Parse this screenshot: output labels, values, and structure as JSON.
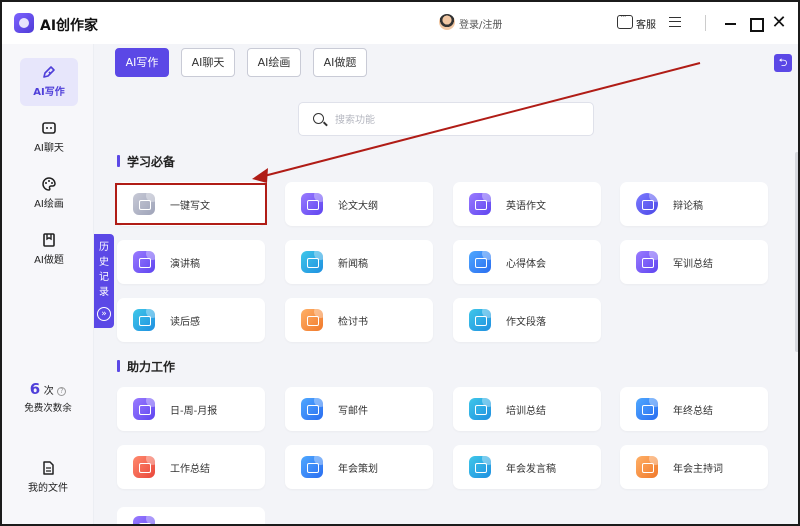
{
  "app": {
    "title": "AI创作家"
  },
  "titlebar": {
    "login_label": "登录/注册",
    "service_label": "客服"
  },
  "sidebar": {
    "items": [
      {
        "label": "AI写作",
        "icon": "pen-icon",
        "active": true
      },
      {
        "label": "AI聊天",
        "icon": "chat-bot-icon",
        "active": false
      },
      {
        "label": "AI绘画",
        "icon": "palette-icon",
        "active": false
      },
      {
        "label": "AI做题",
        "icon": "bookmark-icon",
        "active": false
      }
    ],
    "credits": {
      "count": "6",
      "unit": "次",
      "info": "?",
      "label": "免费次数余"
    },
    "files": {
      "label": "我的文件",
      "icon": "file-icon"
    }
  },
  "history_tab": {
    "chars": [
      "历",
      "史",
      "记",
      "录"
    ],
    "toggle": "»"
  },
  "tabs": [
    "AI写作",
    "AI聊天",
    "AI绘画",
    "AI做题"
  ],
  "search": {
    "placeholder": "搜索功能"
  },
  "sections": [
    {
      "title": "学习必备",
      "items": [
        "一键写文",
        "论文大纲",
        "英语作文",
        "辩论稿",
        "演讲稿",
        "新闻稿",
        "心得体会",
        "军训总结",
        "读后感",
        "检讨书",
        "作文段落"
      ]
    },
    {
      "title": "助力工作",
      "items": [
        "日-周-月报",
        "写邮件",
        "培训总结",
        "年终总结",
        "工作总结",
        "年会策划",
        "年会发言稿",
        "年会主持词"
      ]
    }
  ],
  "colors": {
    "accent": "#5b48e6",
    "annotation": "#b01c16"
  }
}
